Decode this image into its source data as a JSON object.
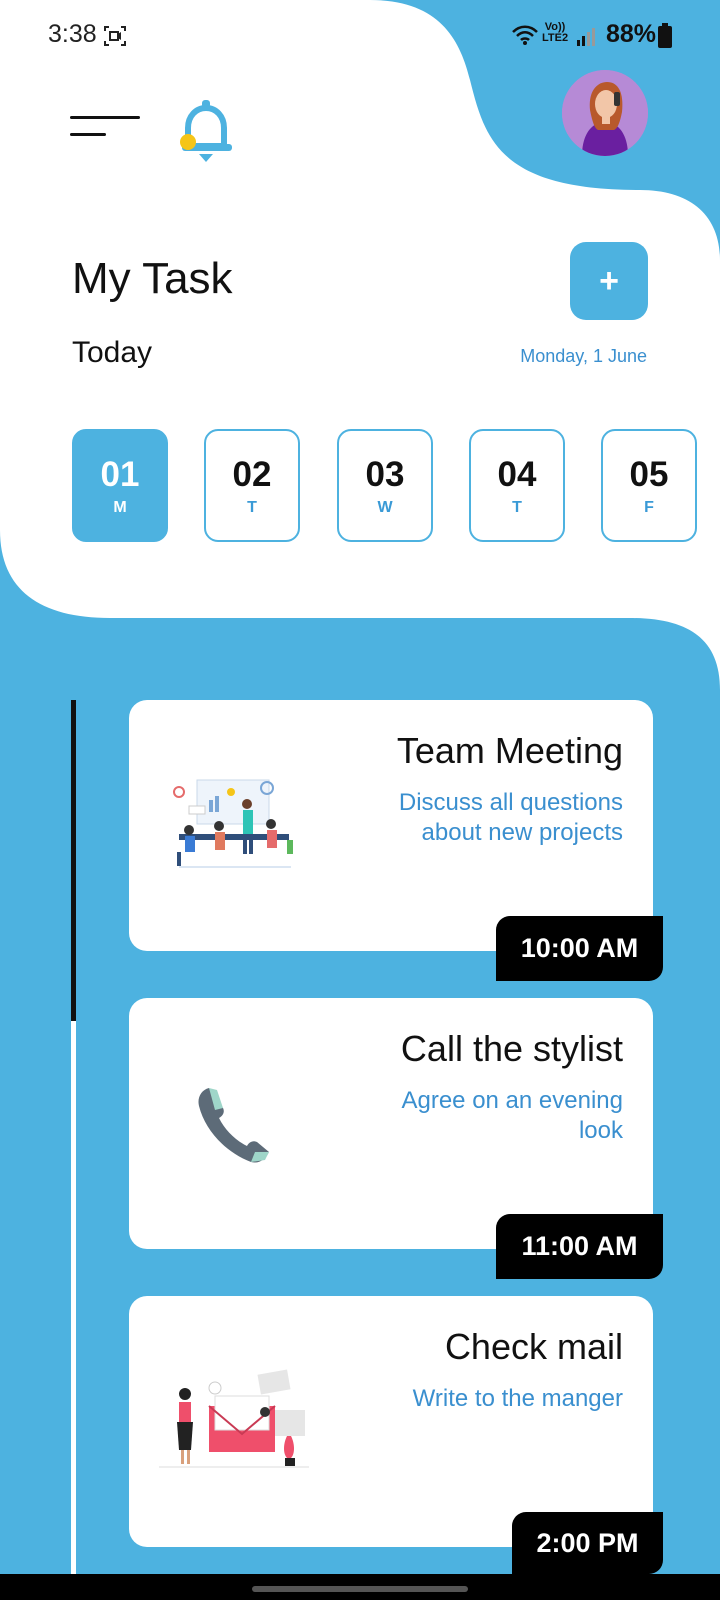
{
  "status_bar": {
    "time": "3:38",
    "network_line1": "Vo))",
    "network_line2": "LTE2",
    "battery": "88%"
  },
  "header": {
    "menu_icon": "menu-icon",
    "bell_icon": "bell-icon",
    "avatar_icon": "avatar"
  },
  "title": "My Task",
  "add_label": "+",
  "today_label": "Today",
  "date_label": "Monday, 1 June",
  "days": [
    {
      "num": "01",
      "letter": "M",
      "selected": true
    },
    {
      "num": "02",
      "letter": "T",
      "selected": false
    },
    {
      "num": "03",
      "letter": "W",
      "selected": false
    },
    {
      "num": "04",
      "letter": "T",
      "selected": false
    },
    {
      "num": "05",
      "letter": "F",
      "selected": false
    }
  ],
  "tasks": [
    {
      "title": "Team Meeting",
      "description": "Discuss all questions about new projects",
      "time": "10:00 AM",
      "illustration": "team-meeting-illustration"
    },
    {
      "title": "Call the stylist",
      "description": "Agree on an evening look",
      "time": "11:00 AM",
      "illustration": "phone-icon"
    },
    {
      "title": "Check mail",
      "description": "Write to the manger",
      "time": "2:00 PM",
      "illustration": "mail-illustration"
    }
  ],
  "colors": {
    "accent": "#4db2e0",
    "link_text": "#3a8fcf",
    "badge": "#000000"
  }
}
